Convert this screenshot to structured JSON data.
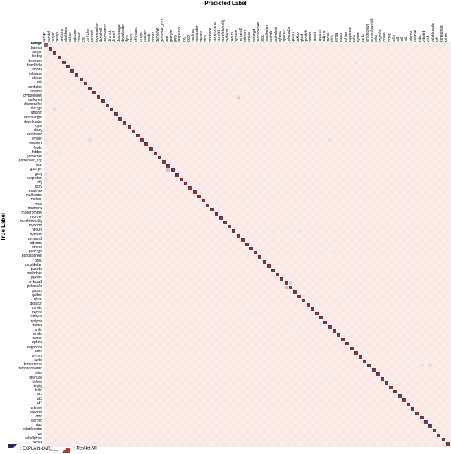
{
  "titles": {
    "top": "Predicted Label",
    "left": "True Label"
  },
  "legend": {
    "seriesA": "EXPLAIN-OvR",
    "seriesA_sub": "Union",
    "seriesB": "ResNet.MI"
  },
  "labels": [
    "benign",
    "bamital",
    "banjori",
    "bedep",
    "beebone",
    "blackhole",
    "bobax",
    "ccleaner",
    "chinad",
    "chir",
    "conficker",
    "corebot",
    "cryptolocker",
    "darkshell",
    "diamondfox",
    "dircrypt",
    "dmsniff",
    "dnschanger",
    "downloader",
    "dyre",
    "ebury",
    "ekforward",
    "emotet",
    "enviserv",
    "feodo",
    "fobber",
    "gameover",
    "gameover_p2p",
    "gozi",
    "goznym",
    "gspy",
    "hesperbot",
    "infy",
    "locky",
    "madmax",
    "makloader",
    "matsnu",
    "mirai",
    "modpack",
    "monerominer",
    "murofet",
    "murofetweekly",
    "mydoom",
    "necurs",
    "nymaim",
    "nymaim2",
    "oderoor",
    "omexo",
    "padcrypt",
    "pandabanker",
    "pitou",
    "proslikefan",
    "pushdo",
    "pushdotid",
    "pykspa",
    "pykspa2",
    "pykspa2s",
    "qadars",
    "qakbot",
    "qhost",
    "qsnatch",
    "ramdo",
    "ramnit",
    "ranbyus",
    "redyms",
    "rovnix",
    "shifu",
    "simda",
    "sisron",
    "sphinx",
    "suppobox",
    "sutra",
    "symmi",
    "szribi",
    "tempedreve",
    "tempedrevetdd",
    "tinba",
    "tinynuke",
    "tofsee",
    "torpig",
    "tsifiri",
    "ud2",
    "ud3",
    "ud4",
    "urlzone",
    "vawtrak",
    "vidro",
    "vidrotid",
    "virut",
    "volatilecedar",
    "wd",
    "xshellghost",
    "xxhex"
  ],
  "chart_data": {
    "type": "heatmap",
    "title": "",
    "xlabel": "Predicted Label",
    "ylabel": "True Label",
    "categories": "labels",
    "series": [
      {
        "name": "EXPLAIN-OvR_Union",
        "shape": "upper-left-triangle",
        "color_high": "#1f2b60",
        "color_low": "#d4dbe8"
      },
      {
        "name": "ResNet.MI",
        "shape": "lower-right-triangle",
        "color_high": "#7a1414",
        "color_low": "#f4d3cd"
      }
    ],
    "value_domain": [
      0.0,
      1.0
    ],
    "note": "confusion-matrix; strong diagonal ~0.85–1.0 for both series; off-diagonal values are mostly 0.0–0.05 with a few 0.1–0.3 entries",
    "diagonal_estimate": 0.92,
    "offdiag_cells": [
      {
        "row": "benign",
        "col": "benign",
        "A": 0.75,
        "B": 0.7
      },
      {
        "row": "beebone",
        "col": "bedep",
        "A": 0.1,
        "B": 0.08
      },
      {
        "row": "beebone",
        "col": "sutra",
        "A": 0.1,
        "B": 0.08
      },
      {
        "row": "bobax",
        "col": "necurs",
        "A": 0.05,
        "B": 0.04
      },
      {
        "row": "conficker",
        "col": "nymaim2",
        "A": 0.05,
        "B": 0.04
      },
      {
        "row": "cryptolocker",
        "col": "nymaim",
        "A": 0.1,
        "B": 0.2
      },
      {
        "row": "cryptolocker",
        "col": "ramdo",
        "A": 0.06,
        "B": 0.05
      },
      {
        "row": "dircrypt",
        "col": "banjori",
        "A": 0.18,
        "B": 0.1
      },
      {
        "row": "dircrypt",
        "col": "chinad",
        "A": 0.1,
        "B": 0.08
      },
      {
        "row": "dircrypt",
        "col": "ebury",
        "A": 0.05,
        "B": 0.04
      },
      {
        "row": "dircrypt",
        "col": "vidro",
        "A": 0.08,
        "B": 0.06
      },
      {
        "row": "dircrypt",
        "col": "virut",
        "A": 0.08,
        "B": 0.06
      },
      {
        "row": "emotet",
        "col": "benign",
        "A": 0.1,
        "B": 0.08
      },
      {
        "row": "emotet",
        "col": "conficker",
        "A": 0.12,
        "B": 0.1
      },
      {
        "row": "emotet",
        "col": "rovnix",
        "A": 0.12,
        "B": 0.1
      },
      {
        "row": "emotet",
        "col": "hesperbot",
        "A": 0.05,
        "B": 0.04
      },
      {
        "row": "fobber",
        "col": "benign",
        "A": 0.08,
        "B": 0.1
      },
      {
        "row": "fobber",
        "col": "bedep",
        "A": 0.08,
        "B": 0.06
      },
      {
        "row": "fobber",
        "col": "monerominer",
        "A": 0.05,
        "B": 0.04
      },
      {
        "row": "fobber",
        "col": "dyre",
        "A": 0.05,
        "B": 0.04
      },
      {
        "row": "goznym",
        "col": "gozi",
        "A": 0.25,
        "B": 0.25
      },
      {
        "row": "gspy",
        "col": "benign",
        "A": 0.12,
        "B": 0.08
      },
      {
        "row": "hesperbot",
        "col": "benign",
        "A": 0.12,
        "B": 0.1
      },
      {
        "row": "hesperbot",
        "col": "conficker",
        "A": 0.1,
        "B": 0.08
      },
      {
        "row": "hesperbot",
        "col": "pushdo",
        "A": 0.05,
        "B": 0.04
      },
      {
        "row": "hesperbot",
        "col": "emotet",
        "A": 0.05,
        "B": 0.04
      },
      {
        "row": "mirai",
        "col": "omexo",
        "A": 0.06,
        "B": 0.05
      },
      {
        "row": "murofet",
        "col": "gameover",
        "A": 0.05,
        "B": 0.04
      },
      {
        "row": "murofet",
        "col": "qakbot",
        "A": 0.05,
        "B": 0.04
      },
      {
        "row": "necurs",
        "col": "qakbot",
        "A": 0.06,
        "B": 0.1
      },
      {
        "row": "necurs",
        "col": "bobax",
        "A": 0.05,
        "B": 0.04
      },
      {
        "row": "nymaim",
        "col": "benign",
        "A": 0.08,
        "B": 0.06
      },
      {
        "row": "nymaim",
        "col": "pushdo",
        "A": 0.06,
        "B": 0.05
      },
      {
        "row": "oderoor",
        "col": "benign",
        "A": 0.08,
        "B": 0.06
      },
      {
        "row": "padcrypt",
        "col": "shifu",
        "A": 0.08,
        "B": 0.06
      },
      {
        "row": "pykspa2s",
        "col": "pykspa2",
        "A": 0.3,
        "B": 0.28
      },
      {
        "row": "pykspa2",
        "col": "pykspa2s",
        "A": 0.2,
        "B": 0.18
      },
      {
        "row": "pykspa",
        "col": "benign",
        "A": 0.05,
        "B": 0.04
      },
      {
        "row": "qsnatch",
        "col": "benign",
        "A": 0.05,
        "B": 0.04
      },
      {
        "row": "qadars",
        "col": "simda",
        "A": 0.06,
        "B": 0.05
      },
      {
        "row": "ramnit",
        "col": "conficker",
        "A": 0.06,
        "B": 0.05
      },
      {
        "row": "ramnit",
        "col": "oderoor",
        "A": 0.06,
        "B": 0.05
      },
      {
        "row": "ramnit",
        "col": "padcrypt",
        "A": 0.06,
        "B": 0.05
      },
      {
        "row": "simda",
        "col": "qadars",
        "A": 0.06,
        "B": 0.05
      },
      {
        "row": "szribi",
        "col": "symmi",
        "A": 0.05,
        "B": 0.04
      },
      {
        "row": "tempedreve",
        "col": "virut",
        "A": 0.14,
        "B": 0.12
      },
      {
        "row": "tempedreve",
        "col": "vidro",
        "A": 0.1,
        "B": 0.08
      },
      {
        "row": "tempedreve",
        "col": "vawtrak",
        "A": 0.05,
        "B": 0.04
      },
      {
        "row": "tempedreve",
        "col": "vidrotid",
        "A": 0.05,
        "B": 0.04
      },
      {
        "row": "tinynuke",
        "col": "shifu",
        "A": 0.06,
        "B": 0.05
      },
      {
        "row": "tofsee",
        "col": "benign",
        "A": 0.05,
        "B": 0.04
      },
      {
        "row": "vawtrak",
        "col": "benign",
        "A": 0.05,
        "B": 0.04
      },
      {
        "row": "vidrotid",
        "col": "vidro",
        "A": 0.14,
        "B": 0.12
      },
      {
        "row": "vidro",
        "col": "vidrotid",
        "A": 0.08,
        "B": 0.06
      },
      {
        "row": "wd",
        "col": "benign",
        "A": 0.05,
        "B": 0.04
      },
      {
        "row": "xxhex",
        "col": "xshellghost",
        "A": 0.0,
        "B": 0.12
      }
    ]
  }
}
